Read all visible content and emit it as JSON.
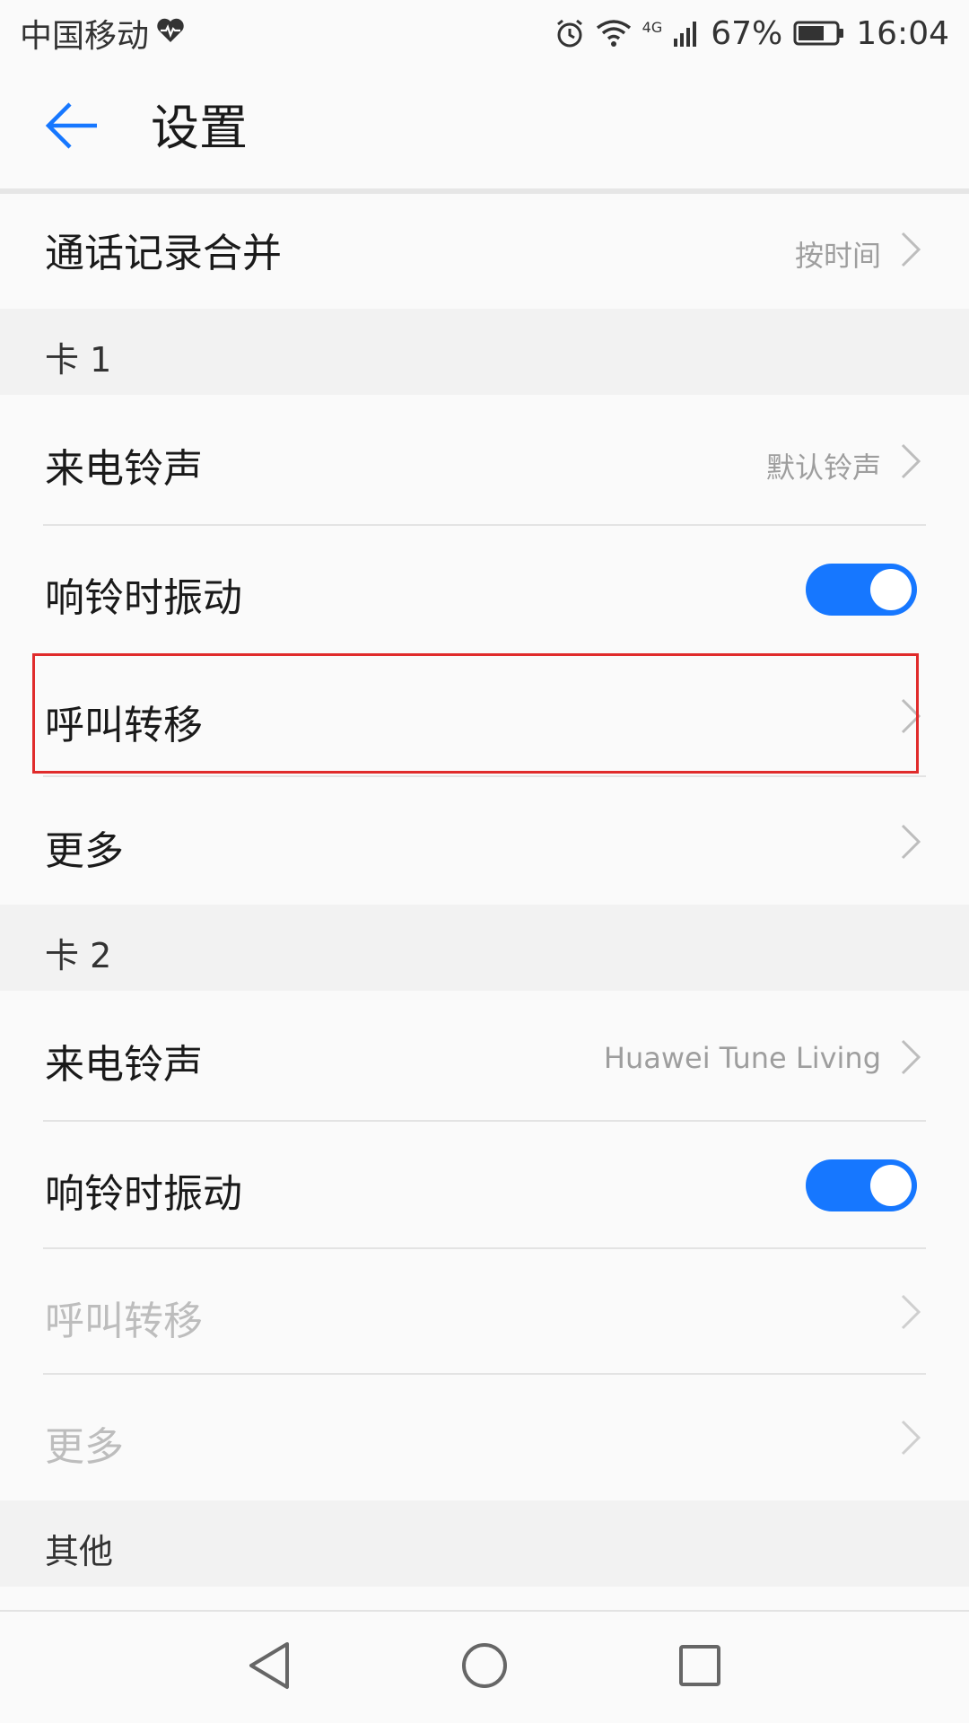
{
  "status_bar": {
    "carrier": "中国移动",
    "network": "4G",
    "battery": "67%",
    "time": "16:04",
    "icons": [
      "heart-pulse-icon",
      "alarm-icon",
      "wifi-icon",
      "signal-icon",
      "battery-icon"
    ]
  },
  "header": {
    "title": "设置"
  },
  "top_row": {
    "label": "通话记录合并",
    "value": "按时间"
  },
  "sim1": {
    "section_label": "卡 1",
    "ringtone_label": "来电铃声",
    "ringtone_value": "默认铃声",
    "vibrate_label": "响铃时振动",
    "vibrate_on": true,
    "forward_label": "呼叫转移",
    "more_label": "更多"
  },
  "sim2": {
    "section_label": "卡 2",
    "ringtone_label": "来电铃声",
    "ringtone_value": "Huawei Tune Living",
    "vibrate_label": "响铃时振动",
    "vibrate_on": true,
    "forward_label": "呼叫转移",
    "more_label": "更多"
  },
  "other": {
    "section_label": "其他"
  },
  "colors": {
    "accent": "#1677ff",
    "highlight": "#e02b2b",
    "disabled_text": "#bdbdbd"
  }
}
